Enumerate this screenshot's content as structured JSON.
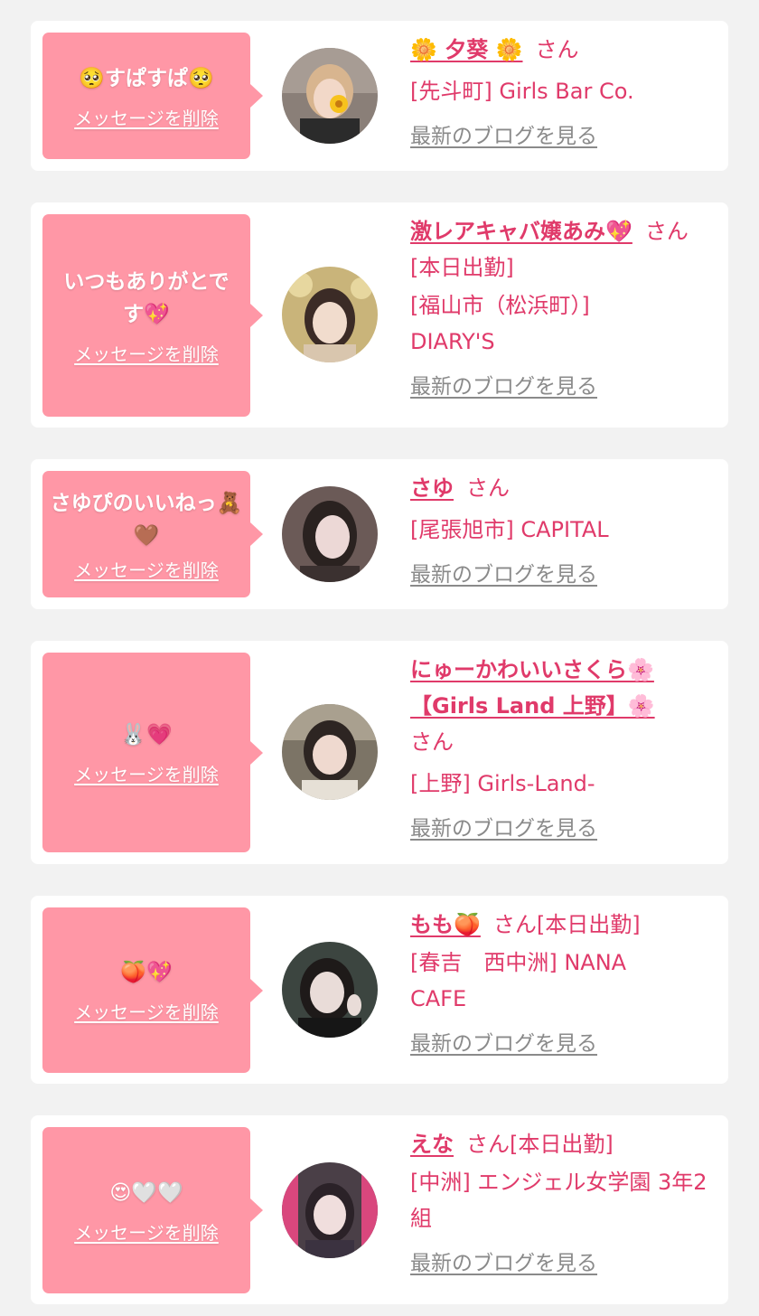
{
  "common": {
    "delete_label": "メッセージを削除",
    "blog_label": "最新のブログを見る",
    "san": "さん"
  },
  "colors": {
    "background": "#f2f2f2",
    "card": "#ffffff",
    "bubble": "#ff97a6",
    "name": "#e03a6a",
    "blog_link": "#8a8a8a"
  },
  "items": [
    {
      "message": "🥺すぱすぱ🥺",
      "name": "🌼 夕葵 🌼",
      "status": "",
      "shop": "[先斗町] Girls Bar Co.",
      "avatar_icon": "photo-avatar-1"
    },
    {
      "message": "いつもありがとです💖",
      "name": "激レアキャバ嬢あみ💖",
      "status": "[本日出勤]",
      "shop": "[福山市（松浜町）] DIARY'S",
      "avatar_icon": "photo-avatar-2"
    },
    {
      "message": "さゆぴのいいねっ🧸🤎",
      "name": "さゆ",
      "status": "",
      "shop": "[尾張旭市] CAPITAL",
      "avatar_icon": "photo-avatar-3"
    },
    {
      "message": "🐰💗",
      "name": "にゅーかわいいさくら🌸【Girls Land 上野】🌸",
      "status": "",
      "shop": "[上野] Girls-Land-",
      "avatar_icon": "photo-avatar-4"
    },
    {
      "message": "🍑💖",
      "name": "もも🍑",
      "status": "[本日出勤]",
      "shop": "[春吉　西中洲] NANA CAFE",
      "avatar_icon": "photo-avatar-5"
    },
    {
      "message": "😍🤍🤍",
      "name": "えな",
      "status": "[本日出勤]",
      "shop": "[中洲] エンジェル女学園 3年2組",
      "avatar_icon": "photo-avatar-6"
    }
  ]
}
